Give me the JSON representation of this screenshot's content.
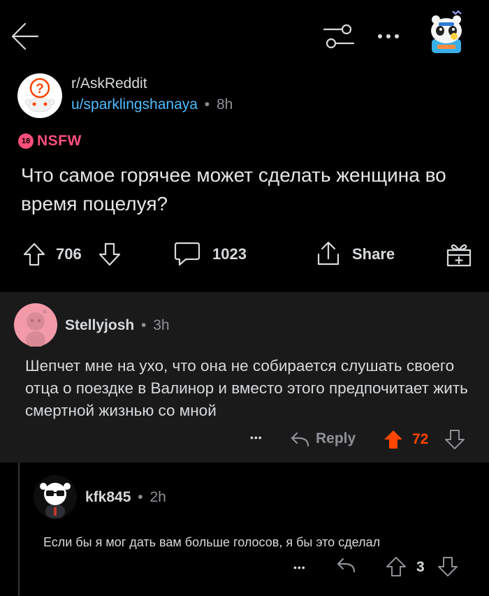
{
  "post": {
    "subreddit": "r/AskReddit",
    "author": "u/sparklingshanaya",
    "sep": "•",
    "age": "8h",
    "nsfw_label": "NSFW",
    "nsfw_badge": "18",
    "title": "Что самое горячее может сделать женщина во время поцелуя?",
    "upvotes": "706",
    "comments": "1023",
    "share_label": "Share"
  },
  "comments": [
    {
      "author": "Stellyjosh",
      "sep": "•",
      "age": "3h",
      "body": "Шепчет мне на ухо, что она не собирается слушать своего отца о поездке в Валинор и вместо этого предпочитает жить смертной жизнью со мной",
      "more": "•••",
      "reply_label": "Reply",
      "score": "72",
      "vote_state": "upvoted",
      "upvote_color": "#ff4500"
    },
    {
      "author": "kfk845",
      "sep": "•",
      "age": "2h",
      "body": "Если бы я мог дать вам больше голосов, я бы это сделал",
      "more": "•••",
      "score": "3"
    }
  ],
  "colors": {
    "background": "#000000",
    "comment_bg": "#1a1a1b",
    "author_link": "#4fbcff",
    "nsfw": "#ff4f7b",
    "upvoted": "#ff4500"
  }
}
